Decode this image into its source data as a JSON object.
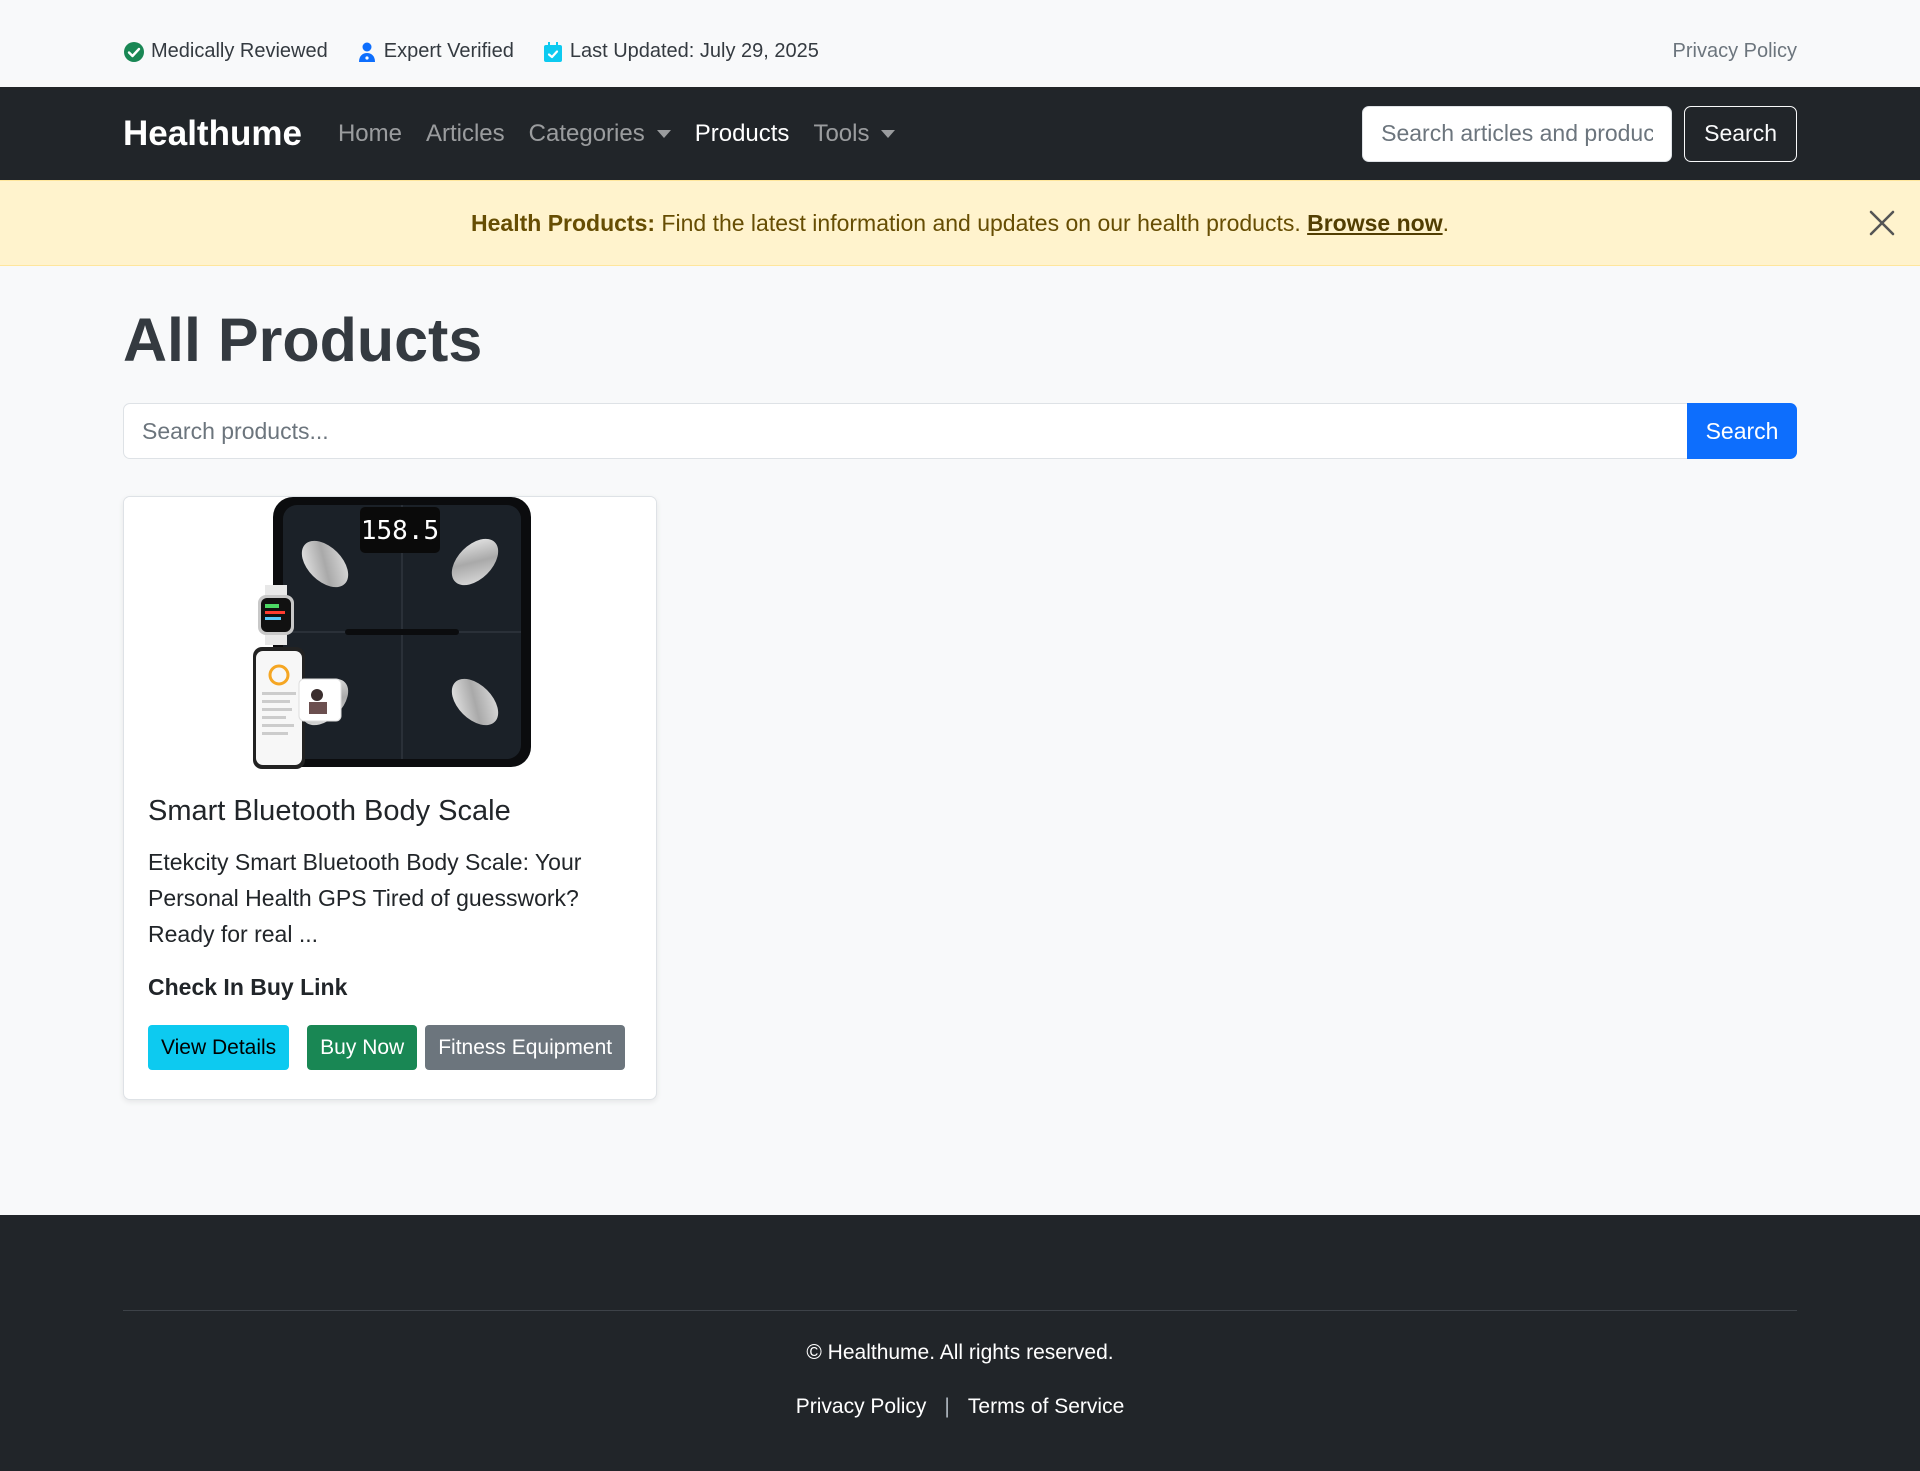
{
  "topbar": {
    "medically_reviewed": "Medically Reviewed",
    "expert_verified": "Expert Verified",
    "last_updated": "Last Updated: July 29, 2025",
    "privacy": "Privacy Policy"
  },
  "navbar": {
    "brand": "Healthume",
    "links": [
      "Home",
      "Articles",
      "Categories",
      "Products",
      "Tools"
    ],
    "active": "Products",
    "search_placeholder": "Search articles and products...",
    "search_button": "Search"
  },
  "alert": {
    "lead": "Health Products:",
    "text": " Find the latest information and updates on our health products. ",
    "link": "Browse now",
    "end": "."
  },
  "main": {
    "title": "All Products",
    "search_placeholder": "Search products...",
    "search_button": "Search"
  },
  "product": {
    "scale_display": "158.5",
    "title": "Smart Bluetooth Body Scale",
    "description": "Etekcity Smart Bluetooth Body Scale: Your Personal Health GPS Tired of guesswork? Ready for real ...",
    "price": "Check In Buy Link",
    "details_button": "View Details",
    "buy_button": "Buy Now",
    "category_button": "Fitness Equipment"
  },
  "footer": {
    "copyright": "© Healthume. All rights reserved.",
    "privacy": "Privacy Policy",
    "separator": "|",
    "terms": "Terms of Service"
  },
  "colors": {
    "navbar": "#212529",
    "primary": "#0d6efd",
    "info": "#0dcaf0",
    "success": "#198754",
    "secondary": "#6c757d",
    "alert_bg": "#fff3cd"
  }
}
